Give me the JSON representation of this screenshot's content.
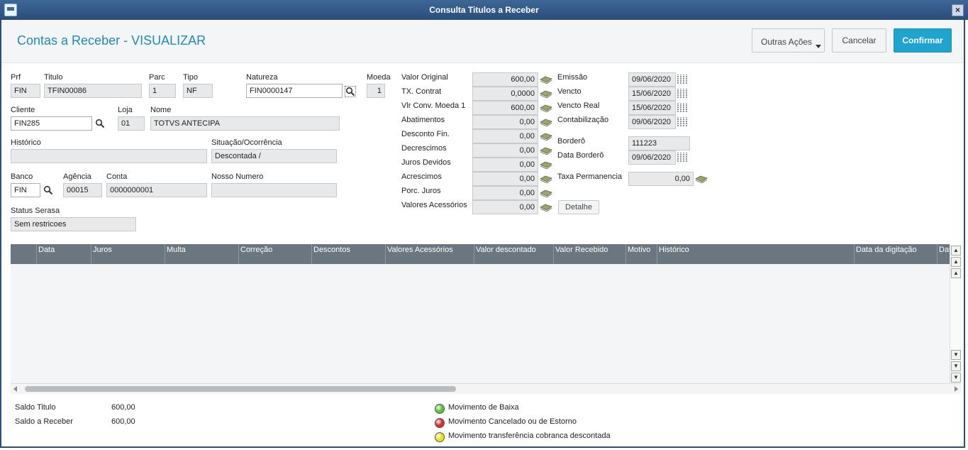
{
  "window": {
    "title": "Consulta Titulos a Receber",
    "close": "×"
  },
  "header": {
    "page_title": "Contas a Receber - VISUALIZAR",
    "other_actions": "Outras Ações",
    "cancel": "Cancelar",
    "confirm": "Confirmar"
  },
  "form": {
    "prf": {
      "label": "Prf",
      "value": "FIN"
    },
    "titulo": {
      "label": "Titulo",
      "value": "TFIN00086"
    },
    "parc": {
      "label": "Parc",
      "value": "1"
    },
    "tipo": {
      "label": "Tipo",
      "value": "NF"
    },
    "natureza": {
      "label": "Natureza",
      "value": "FIN0000147"
    },
    "moeda": {
      "label": "Moeda",
      "value": "1"
    },
    "cliente": {
      "label": "Cliente",
      "value": "FIN285"
    },
    "loja": {
      "label": "Loja",
      "value": "01"
    },
    "nome": {
      "label": "Nome",
      "value": "TOTVS ANTECIPA"
    },
    "historico": {
      "label": "Histórico",
      "value": ""
    },
    "situacao": {
      "label": "Situação/Ocorrência",
      "value": "Descontada /"
    },
    "banco": {
      "label": "Banco",
      "value": "FIN"
    },
    "agencia": {
      "label": "Agência",
      "value": "00015"
    },
    "conta": {
      "label": "Conta",
      "value": "0000000001"
    },
    "nosso_numero": {
      "label": "Nosso Numero",
      "value": ""
    },
    "status_serasa": {
      "label": "Status Serasa",
      "value": "Sem restricoes"
    }
  },
  "values": [
    {
      "label": "Valor Original",
      "value": "600,00"
    },
    {
      "label": "TX. Contrat",
      "value": "0,0000"
    },
    {
      "label": "Vlr Conv. Moeda 1",
      "value": "600,00"
    },
    {
      "label": "Abatimentos",
      "value": "0,00"
    },
    {
      "label": "Desconto Fin.",
      "value": "0,00"
    },
    {
      "label": "Decrescimos",
      "value": "0,00"
    },
    {
      "label": "Juros Devidos",
      "value": "0,00"
    },
    {
      "label": "Acrescimos",
      "value": "0,00"
    },
    {
      "label": "Porc. Juros",
      "value": "0,00"
    },
    {
      "label": "Valores Acessórios",
      "value": "0,00"
    }
  ],
  "detail_button": "Detalhe",
  "dates": [
    {
      "label": "Emissão",
      "value": "09/06/2020"
    },
    {
      "label": "Vencto",
      "value": "15/06/2020"
    },
    {
      "label": "Vencto Real",
      "value": "15/06/2020"
    },
    {
      "label": "Contabilização",
      "value": "09/06/2020"
    }
  ],
  "bordero": {
    "label": "Borderô",
    "value": "111223"
  },
  "data_bordero": {
    "label": "Data Borderô",
    "value": "09/06/2020"
  },
  "taxa_permanencia": {
    "label": "Taxa Permanencia",
    "value": "0,00"
  },
  "grid": {
    "columns": [
      "Data",
      "Juros",
      "Multa",
      "Correção",
      "Descontos",
      "Valores Acessórios",
      "Valor descontado",
      "Valor Recebido",
      "Motivo",
      "Histórico",
      "Data da digitação",
      "Dat"
    ]
  },
  "footer": {
    "saldo_titulo": {
      "label": "Saldo Titulo",
      "value": "600,00"
    },
    "saldo_receber": {
      "label": "Saldo a Receber",
      "value": "600,00"
    },
    "legend": [
      {
        "label": "Movimento de Baixa",
        "color": "#5cc43a"
      },
      {
        "label": "Movimento Cancelado ou de Estorno",
        "color": "#e02a2a"
      },
      {
        "label": "Movimento transferência cobranca descontada",
        "color": "#e8e21e"
      }
    ]
  }
}
